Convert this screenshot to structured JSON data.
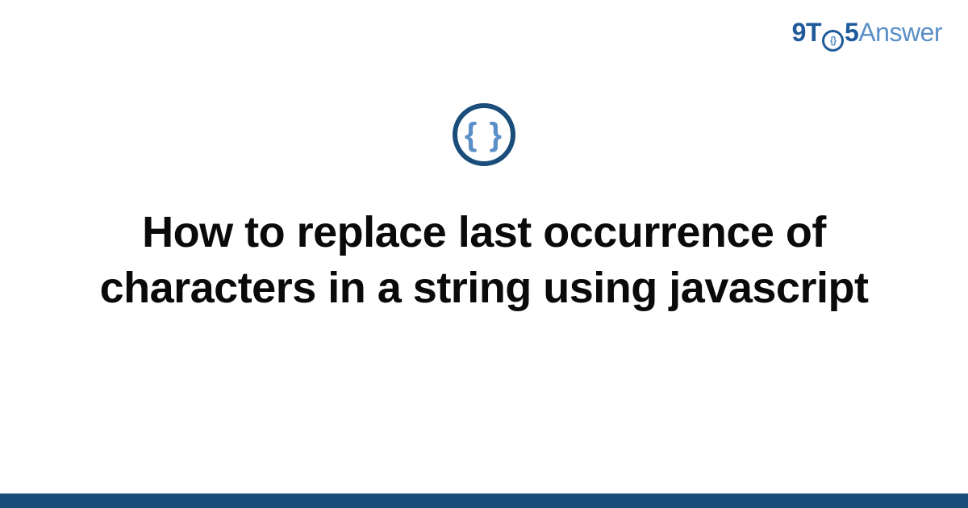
{
  "brand": {
    "part1": "9T",
    "circle_inner": "{}",
    "part2": "5",
    "part3": "Answer"
  },
  "topic_icon": {
    "glyph": "{ }",
    "semantic": "code-braces-icon"
  },
  "heading": "How to replace last occurrence of characters in a string using javascript",
  "colors": {
    "brand_dark": "#1a4d7a",
    "brand_mid": "#1f5a9a",
    "brand_light": "#5a8fc7",
    "text": "#0a0a0a",
    "background": "#ffffff"
  }
}
